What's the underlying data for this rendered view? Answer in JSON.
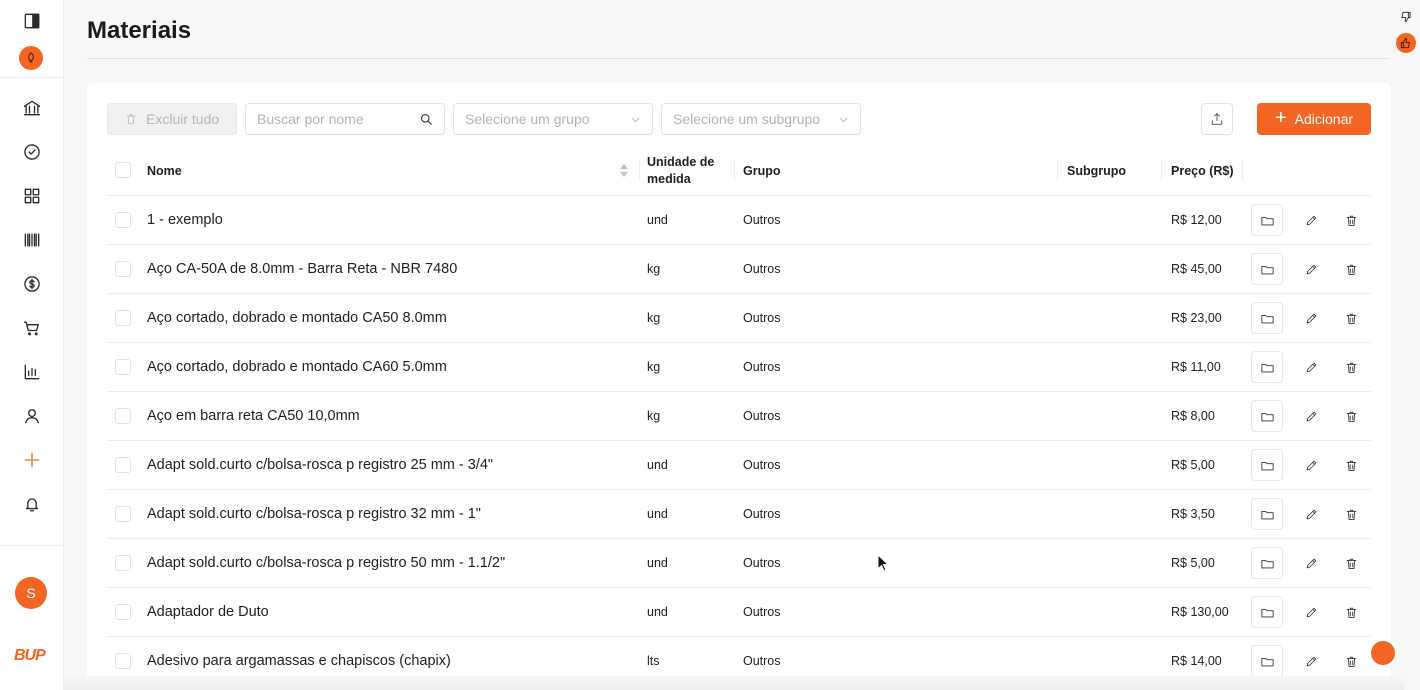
{
  "page": {
    "title": "Materiais"
  },
  "toolbar": {
    "delete_all_label": "Excluir tudo",
    "search_placeholder": "Buscar por nome",
    "group_placeholder": "Selecione um grupo",
    "subgroup_placeholder": "Selecione um subgrupo",
    "add_label": "Adicionar"
  },
  "table": {
    "headers": {
      "name": "Nome",
      "unit": "Unidade de medida",
      "group": "Grupo",
      "subgroup": "Subgrupo",
      "price": "Preço (R$)"
    },
    "rows": [
      {
        "name": "1 - exemplo",
        "unit": "und",
        "group": "Outros",
        "subgroup": "",
        "price": "R$ 12,00"
      },
      {
        "name": "Aço CA-50A de 8.0mm - Barra Reta - NBR 7480",
        "unit": "kg",
        "group": "Outros",
        "subgroup": "",
        "price": "R$ 45,00"
      },
      {
        "name": "Aço cortado, dobrado e montado CA50 8.0mm",
        "unit": "kg",
        "group": "Outros",
        "subgroup": "",
        "price": "R$ 23,00"
      },
      {
        "name": "Aço cortado, dobrado e montado CA60 5.0mm",
        "unit": "kg",
        "group": "Outros",
        "subgroup": "",
        "price": "R$ 11,00"
      },
      {
        "name": "Aço em barra reta CA50 10,0mm",
        "unit": "kg",
        "group": "Outros",
        "subgroup": "",
        "price": "R$ 8,00"
      },
      {
        "name": "Adapt sold.curto c/bolsa-rosca p registro 25 mm - 3/4\"",
        "unit": "und",
        "group": "Outros",
        "subgroup": "",
        "price": "R$ 5,00"
      },
      {
        "name": "Adapt sold.curto c/bolsa-rosca p registro 32 mm - 1\"",
        "unit": "und",
        "group": "Outros",
        "subgroup": "",
        "price": "R$ 3,50"
      },
      {
        "name": "Adapt sold.curto c/bolsa-rosca p registro 50 mm - 1.1/2\"",
        "unit": "und",
        "group": "Outros",
        "subgroup": "",
        "price": "R$ 5,00"
      },
      {
        "name": "Adaptador de Duto",
        "unit": "und",
        "group": "Outros",
        "subgroup": "",
        "price": "R$ 130,00"
      },
      {
        "name": "Adesivo para argamassas e chapiscos (chapix)",
        "unit": "lts",
        "group": "Outros",
        "subgroup": "",
        "price": "R$ 14,00"
      }
    ]
  },
  "sidebar": {
    "icons": [
      "panel-toggle-icon",
      "rocket-icon",
      "bank-icon",
      "check-circle-icon",
      "grid-icon",
      "barcode-icon",
      "dollar-icon",
      "cart-icon",
      "bar-chart-icon",
      "user-icon",
      "plus-icon",
      "bell-icon"
    ],
    "avatar_initial": "S",
    "brand": "BUP"
  },
  "colors": {
    "accent": "#f26522",
    "border": "#ececec",
    "placeholder": "#b3b3b3"
  }
}
